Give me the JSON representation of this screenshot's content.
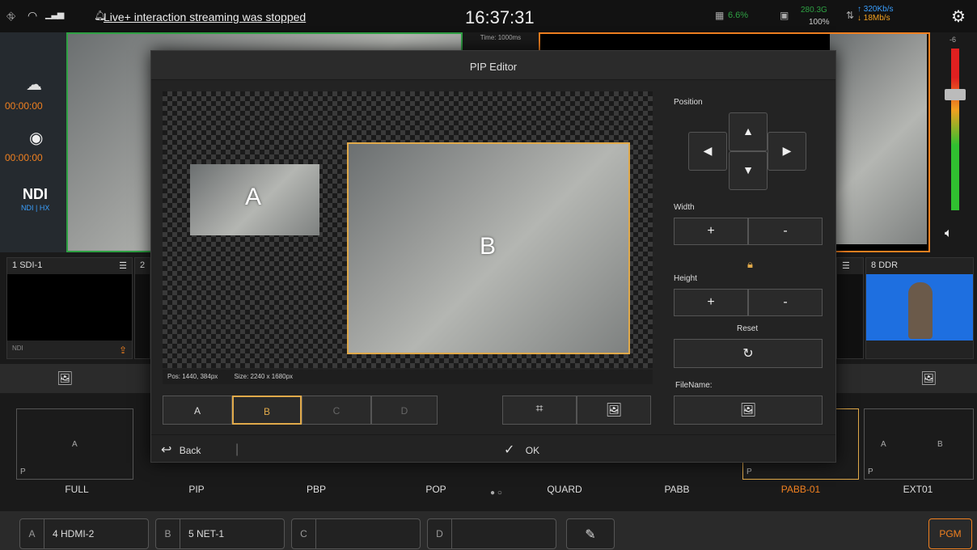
{
  "topbar": {
    "notice": "Live+ interaction streaming was stopped",
    "clock": "16:37:31",
    "cpu": "6.6%",
    "mem_value": "280.3G",
    "mem_pct": "100%",
    "net_up": "↑ 320Kb/s",
    "net_down": "↓ 18Mb/s"
  },
  "left_panel": {
    "stream_time": "00:00:00",
    "record_time": "00:00:00",
    "ndi_logo": "NDI",
    "ndi_sub": "NDI | HX"
  },
  "preview": {
    "time_label": "Time: 1000ms"
  },
  "meter": {
    "top_label": "-6"
  },
  "sources": [
    {
      "num": "1",
      "name": "SDI-1",
      "foot": "NDI"
    },
    {
      "num": "2",
      "name": ""
    },
    {
      "num": "8",
      "name": "DDR"
    }
  ],
  "layouts": [
    "FULL",
    "PIP",
    "PBP",
    "POP",
    "QUARD",
    "PABB",
    "PABB-01",
    "EXT01"
  ],
  "layout_tile": {
    "a": "A",
    "p": "P",
    "b": "B"
  },
  "bottom_slots": [
    {
      "key": "A",
      "value": "4 HDMI-2"
    },
    {
      "key": "B",
      "value": "5 NET-1"
    },
    {
      "key": "C",
      "value": ""
    },
    {
      "key": "D",
      "value": ""
    }
  ],
  "pgm_label": "PGM",
  "dialog": {
    "title": "PIP Editor",
    "win_a": "A",
    "win_b": "B",
    "pos_info": "Pos: 1440, 384px",
    "size_info": "Size: 2240 x 1680px",
    "tabs": [
      "A",
      "B",
      "C",
      "D"
    ],
    "position_label": "Position",
    "width_label": "Width",
    "height_label": "Height",
    "plus": "+",
    "minus": "-",
    "reset_label": "Reset",
    "filename_label": "FileName:",
    "back_label": "Back",
    "ok_label": "OK"
  },
  "colors": {
    "accent": "#e0a94a",
    "pvw": "#2ea043",
    "pgm": "#f08020"
  }
}
